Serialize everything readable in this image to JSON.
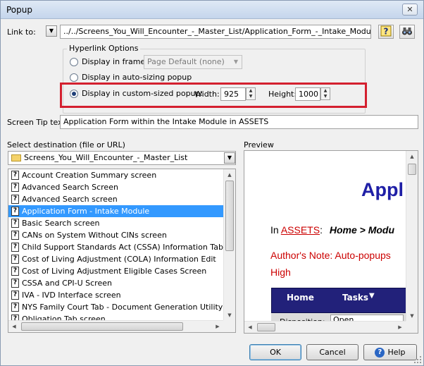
{
  "window": {
    "title": "Popup",
    "close_glyph": "✕"
  },
  "link": {
    "label": "Link to:",
    "value": "../../Screens_You_Will_Encounter_-_Master_List/Application_Form_-_Intake_Module.htm"
  },
  "hyperlink_options": {
    "legend": "Hyperlink Options",
    "display_in_frame_label": "Display in frame:",
    "frame_select_value": "Page Default (none)",
    "auto_sizing_label": "Display in auto-sizing popup",
    "custom_sized_label": "Display in custom-sized popup:",
    "width_label": "Width:",
    "width_value": "925",
    "height_label": "Height:",
    "height_value": "1000",
    "selected_option": "custom_sized"
  },
  "screen_tip": {
    "label": "Screen Tip text:",
    "value": "Application Form within the Intake Module in ASSETS"
  },
  "destination": {
    "label": "Select destination (file or URL)",
    "folder_value": "Screens_You_Will_Encounter_-_Master_List",
    "items": [
      "Account Creation Summary screen",
      "Advanced Search Screen",
      "Advanced Search screen",
      "Application Form - Intake Module",
      "Basic Search screen",
      "CANs on System Without CINs screen",
      "Child Support Standards Act (CSSA) Information Tab",
      "Cost of Living Adjustment (COLA) Information Edit",
      "Cost of Living Adjustment Eligible Cases Screen",
      "CSSA and CPI-U Screen",
      "IVA - IVD Interface screen",
      "NYS Family Court Tab - Document Generation Utility",
      "Obligation Tab screen"
    ],
    "selected_index": 3,
    "list_scroll_fraction": 0.0
  },
  "preview": {
    "label": "Preview",
    "heading": "Appl",
    "in_text": "In",
    "assets_link": "ASSETS",
    "breadcrumb": "Home > Modu",
    "note_line1": "Author's Note:  Auto-popups",
    "note_line2": "High",
    "nav": {
      "home": "Home",
      "tasks": "Tasks"
    },
    "field_label": "Disposition:",
    "field_value": "Open",
    "colors": {
      "heading": "#1f1fa6",
      "link": "#cc0000",
      "note": "#cc0000",
      "nav_bg": "#22217a"
    }
  },
  "buttons": {
    "ok": "OK",
    "cancel": "Cancel",
    "help": "Help"
  },
  "colors": {
    "highlight": "#d4202f",
    "selection": "#3399ff"
  }
}
